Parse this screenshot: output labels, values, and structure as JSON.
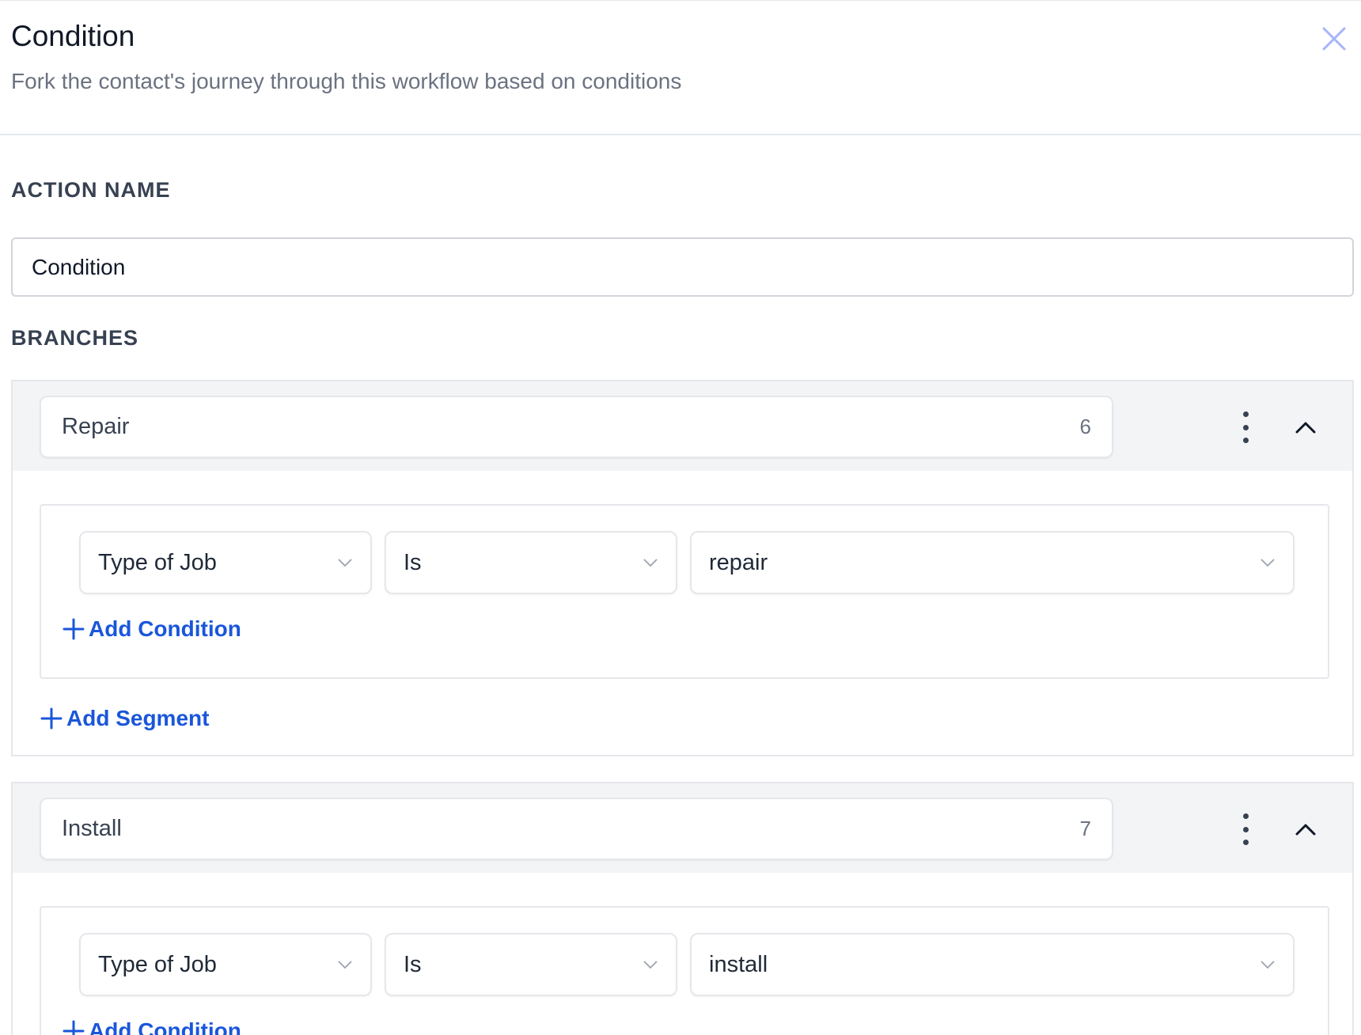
{
  "panel": {
    "title": "Condition",
    "subtitle": "Fork the contact's journey through this workflow based on conditions",
    "close_icon": "close-icon"
  },
  "action_name": {
    "label": "ACTION NAME",
    "value": "Condition"
  },
  "branches_label": "BRANCHES",
  "branches": [
    {
      "name": "Repair",
      "count": "6",
      "condition": {
        "field": "Type of Job",
        "operator": "Is",
        "value": "repair"
      },
      "add_condition_label": "Add Condition",
      "add_segment_label": "Add Segment"
    },
    {
      "name": "Install",
      "count": "7",
      "condition": {
        "field": "Type of Job",
        "operator": "Is",
        "value": "install"
      },
      "add_condition_label": "Add Condition"
    }
  ],
  "colors": {
    "accent": "#1a56db",
    "border": "#e5e7eb",
    "header_bg": "#f3f4f6"
  }
}
